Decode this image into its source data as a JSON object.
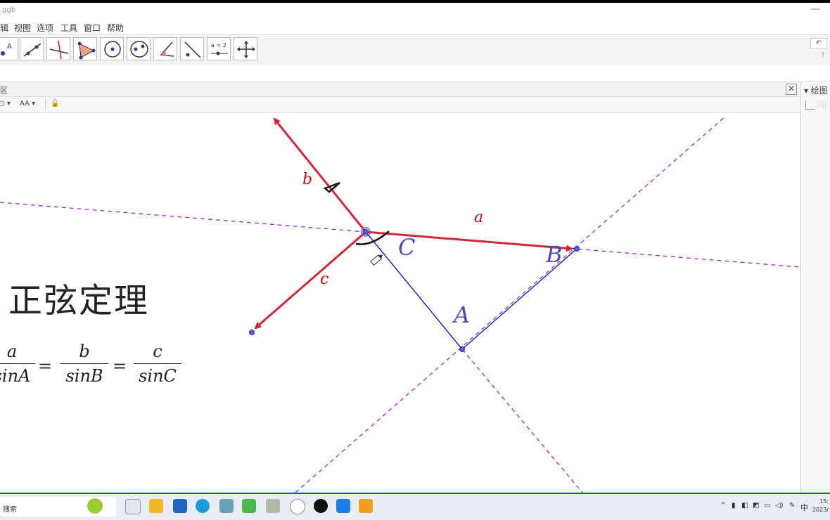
{
  "window": {
    "title": ".ggb"
  },
  "menu": [
    "辑",
    "视图",
    "选项",
    "工具",
    "窗口",
    "帮助"
  ],
  "toolbar": {
    "tools": [
      "point-tool",
      "line-tool",
      "perpendicular-line-tool",
      "polygon-tool",
      "circle-tool",
      "ellipse-tool",
      "angle-tool",
      "reflect-tool",
      "slider-tool",
      "move-view-tool"
    ],
    "slider_label": "a = 2"
  },
  "panel": {
    "header_label": "区",
    "style_font": "AA"
  },
  "right_panel": {
    "title": "▾ 绘图"
  },
  "canvas": {
    "theorem_title": "正弦定理",
    "formula": [
      {
        "num": "a",
        "den": "sinA"
      },
      {
        "num": "b",
        "den": "sinB"
      },
      {
        "num": "c",
        "den": "sinC"
      }
    ],
    "equals": "=",
    "vector_labels": {
      "a": "a",
      "b": "b",
      "c": "c"
    },
    "point_labels": {
      "A": "A",
      "B": "B",
      "C": "C"
    },
    "colors": {
      "vector": "#d0283a",
      "triangle": "#1a1ab8",
      "dashed": "#9b2fc9",
      "point": "#5a5ae0"
    }
  },
  "taskbar": {
    "search_text": "搜索",
    "apps": [
      "task-view",
      "file-explorer",
      "mail",
      "edge",
      "app-5",
      "wechat",
      "app-7",
      "app-8",
      "app-9",
      "app-10",
      "app-11"
    ],
    "ime": "中",
    "time": "15:",
    "date": "2023/"
  }
}
